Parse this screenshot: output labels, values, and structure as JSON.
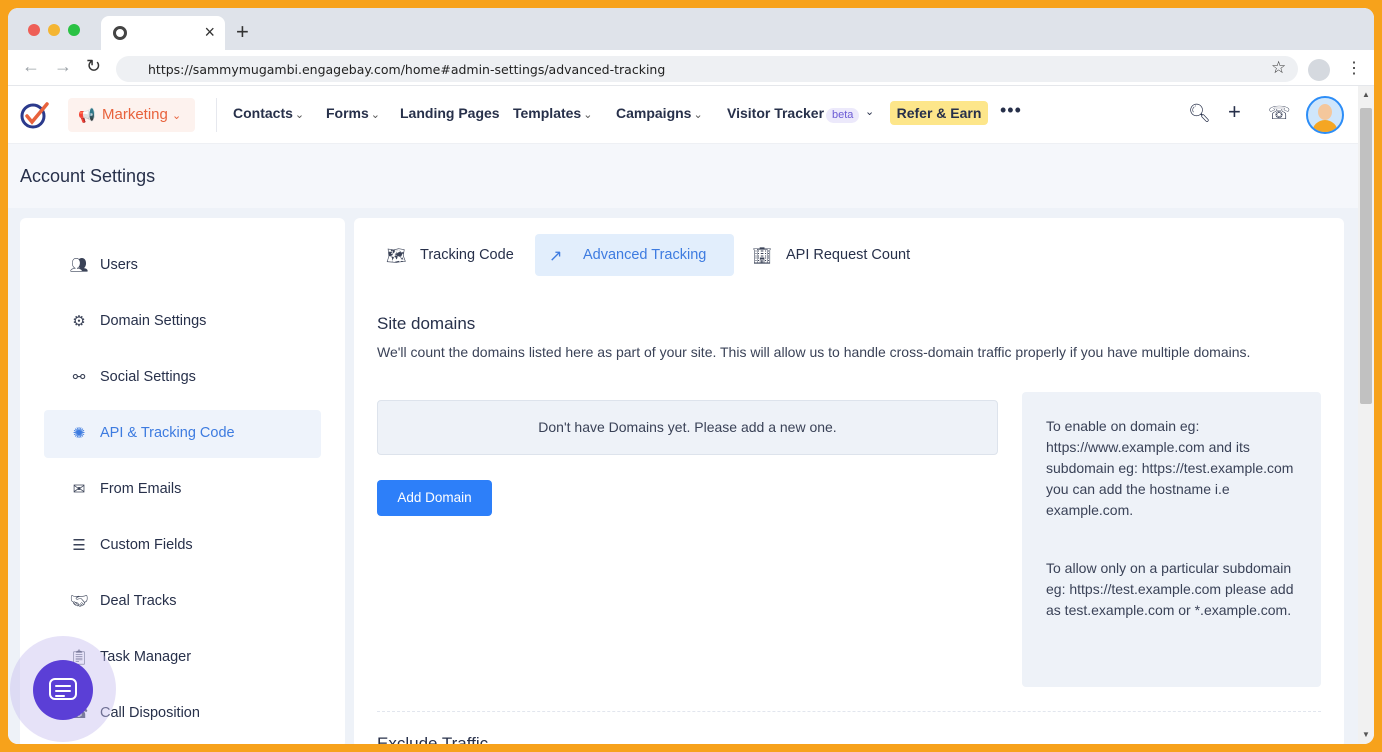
{
  "browser": {
    "url": "https://sammymugambi.engagebay.com/home#admin-settings/advanced-tracking",
    "traffic_lights": [
      "#ee5f57",
      "#f4b532",
      "#2ac244"
    ]
  },
  "header": {
    "module_label": "Marketing",
    "nav": [
      {
        "label": "Contacts",
        "dropdown": true
      },
      {
        "label": "Forms",
        "dropdown": true
      },
      {
        "label": "Landing Pages",
        "dropdown": false
      },
      {
        "label": "Templates",
        "dropdown": true
      },
      {
        "label": "Campaigns",
        "dropdown": true
      },
      {
        "label": "Visitor Tracker",
        "dropdown": true
      }
    ],
    "beta_badge": "beta",
    "refer_label": "Refer & Earn",
    "accent_color": "#e8623c"
  },
  "page": {
    "title": "Account Settings"
  },
  "sidebar": {
    "items": [
      {
        "label": "Users",
        "icon": "users-icon"
      },
      {
        "label": "Domain Settings",
        "icon": "domain-icon"
      },
      {
        "label": "Social Settings",
        "icon": "share-icon"
      },
      {
        "label": "API & Tracking Code",
        "icon": "api-icon",
        "active": true
      },
      {
        "label": "From Emails",
        "icon": "mail-icon"
      },
      {
        "label": "Custom Fields",
        "icon": "sliders-icon"
      },
      {
        "label": "Deal Tracks",
        "icon": "handshake-icon"
      },
      {
        "label": "Task Manager",
        "icon": "clipboard-icon"
      },
      {
        "label": "Call Disposition",
        "icon": "phone-icon"
      }
    ]
  },
  "tabs": [
    {
      "label": "Tracking Code",
      "icon": "tracking-code-icon"
    },
    {
      "label": "Advanced Tracking",
      "icon": "advanced-tracking-icon",
      "active": true
    },
    {
      "label": "API Request Count",
      "icon": "api-request-icon"
    }
  ],
  "content": {
    "heading": "Site domains",
    "description": "We'll count the domains listed here as part of your site. This will allow us to handle cross-domain traffic properly if you have multiple domains.",
    "empty_message": "Don't have Domains yet. Please add a new one.",
    "add_button": "Add Domain",
    "info_paragraph_1": "To enable on domain eg: https://www.example.com and its subdomain eg: https://test.example.com you can add the hostname i.e example.com.",
    "info_paragraph_2": "To allow only on a particular subdomain eg: https://test.example.com please add as test.example.com or *.example.com.",
    "next_heading": "Exclude Traffic",
    "primary_color": "#2d7ff9"
  }
}
